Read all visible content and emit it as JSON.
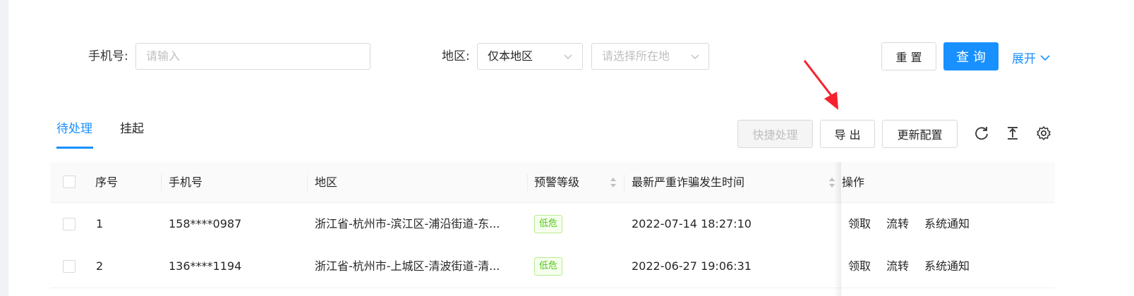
{
  "filters": {
    "phone_label": "手机号:",
    "phone_placeholder": "请输入",
    "region_label": "地区:",
    "region_scope_value": "仅本地区",
    "region_location_placeholder": "请选择所在地",
    "reset_label": "重 置",
    "query_label": "查 询",
    "expand_label": "展开"
  },
  "tabs": [
    {
      "label": "待处理",
      "active": true
    },
    {
      "label": "挂起",
      "active": false
    }
  ],
  "toolbar": {
    "quick_process_label": "快捷处理",
    "export_label": "导 出",
    "update_config_label": "更新配置",
    "icons": [
      "refresh-icon",
      "column-height-icon",
      "settings-icon"
    ]
  },
  "table": {
    "columns": [
      "序号",
      "手机号",
      "地区",
      "预警等级",
      "最新严重诈骗发生时间",
      "操作"
    ],
    "rows": [
      {
        "index": "1",
        "phone": "158****0987",
        "region": "浙江省-杭州市-滨江区-浦沿街道-东...",
        "level": "低危",
        "time": "2022-07-14 18:27:10",
        "actions": [
          "领取",
          "流转",
          "系统通知"
        ]
      },
      {
        "index": "2",
        "phone": "136****1194",
        "region": "浙江省-杭州市-上城区-清波街道-清...",
        "level": "低危",
        "time": "2022-06-27 19:06:31",
        "actions": [
          "领取",
          "流转",
          "系统通知"
        ]
      }
    ]
  },
  "colors": {
    "primary": "#1890ff",
    "annotation_arrow": "#f5222d",
    "tag_green": "#52c41a"
  }
}
